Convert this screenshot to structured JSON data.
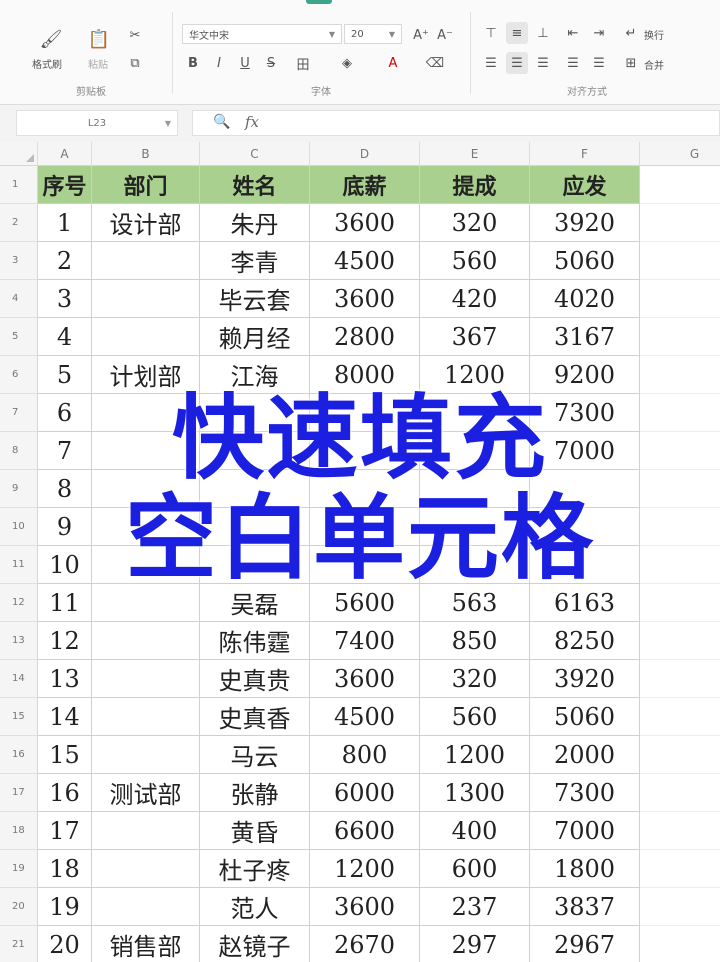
{
  "ribbon": {
    "clipboard": {
      "format_painter_label": "格式刷",
      "paste_label": "粘贴",
      "group_label": "剪贴板"
    },
    "font": {
      "font_name": "华文中宋",
      "font_size": "20",
      "group_label": "字体",
      "buttons": [
        "B",
        "I",
        "U",
        "S"
      ]
    },
    "alignment": {
      "wrap_label": "换行",
      "merge_label": "合并",
      "group_label": "对齐方式"
    }
  },
  "formula_bar": {
    "name_box": "L23",
    "fx_symbol": "fx",
    "formula": ""
  },
  "sheet": {
    "columns": [
      "A",
      "B",
      "C",
      "D",
      "E",
      "F",
      "G"
    ],
    "row_numbers": [
      "1",
      "2",
      "3",
      "4",
      "5",
      "6",
      "7",
      "8",
      "9",
      "10",
      "11",
      "12",
      "13",
      "14",
      "15",
      "16",
      "17",
      "18",
      "19",
      "20",
      "21"
    ],
    "header": [
      "序号",
      "部门",
      "姓名",
      "底薪",
      "提成",
      "应发"
    ],
    "rows": [
      [
        "1",
        "设计部",
        "朱丹",
        "3600",
        "320",
        "3920"
      ],
      [
        "2",
        "",
        "李青",
        "4500",
        "560",
        "5060"
      ],
      [
        "3",
        "",
        "毕云套",
        "3600",
        "420",
        "4020"
      ],
      [
        "4",
        "",
        "赖月经",
        "2800",
        "367",
        "3167"
      ],
      [
        "5",
        "计划部",
        "江海",
        "8000",
        "1200",
        "9200"
      ],
      [
        "6",
        "",
        "",
        "",
        "",
        "7300"
      ],
      [
        "7",
        "",
        "",
        "",
        "",
        "7000"
      ],
      [
        "8",
        "",
        "",
        "",
        "",
        ""
      ],
      [
        "9",
        "",
        "",
        "",
        "",
        ""
      ],
      [
        "10",
        "",
        "",
        "",
        "",
        ""
      ],
      [
        "11",
        "",
        "吴磊",
        "5600",
        "563",
        "6163"
      ],
      [
        "12",
        "",
        "陈伟霆",
        "7400",
        "850",
        "8250"
      ],
      [
        "13",
        "",
        "史真贵",
        "3600",
        "320",
        "3920"
      ],
      [
        "14",
        "",
        "史真香",
        "4500",
        "560",
        "5060"
      ],
      [
        "15",
        "",
        "马云",
        "800",
        "1200",
        "2000"
      ],
      [
        "16",
        "测试部",
        "张静",
        "6000",
        "1300",
        "7300"
      ],
      [
        "17",
        "",
        "黄昏",
        "6600",
        "400",
        "7000"
      ],
      [
        "18",
        "",
        "杜子疼",
        "1200",
        "600",
        "1800"
      ],
      [
        "19",
        "",
        "范人",
        "3600",
        "237",
        "3837"
      ],
      [
        "20",
        "销售部",
        "赵镜子",
        "2670",
        "297",
        "2967"
      ]
    ]
  },
  "overlay": {
    "line1": "快速填充",
    "line2": "空白单元格",
    "color": "#1a1fe0"
  }
}
